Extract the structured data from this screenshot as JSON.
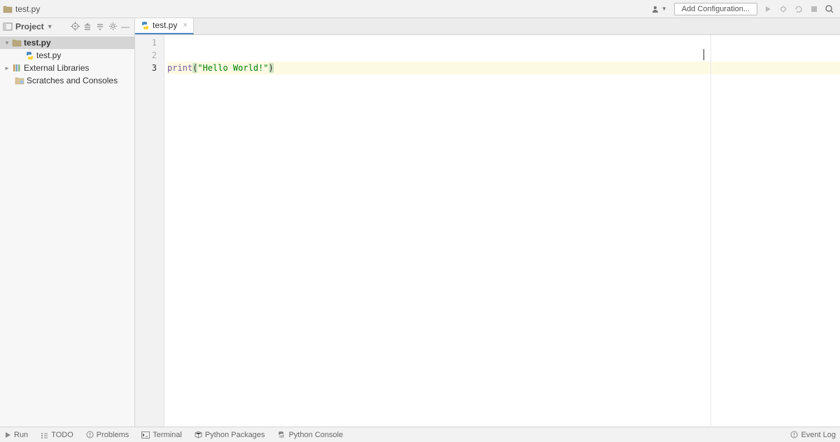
{
  "breadcrumb": {
    "root": "test.py"
  },
  "toolbar": {
    "add_configuration": "Add Configuration..."
  },
  "project": {
    "title": "Project",
    "root": {
      "label": "test.py"
    },
    "file": {
      "label": "test.py"
    },
    "external_libs": "External Libraries",
    "scratches": "Scratches and Consoles"
  },
  "editor": {
    "tab_label": "test.py",
    "lines": {
      "l1": "1",
      "l2": "2",
      "l3": "3"
    },
    "code": {
      "fn": "print",
      "open": "(",
      "close": ")",
      "str": "\"Hello World!\""
    }
  },
  "statusbar": {
    "run": "Run",
    "todo": "TODO",
    "problems": "Problems",
    "terminal": "Terminal",
    "python_packages": "Python Packages",
    "python_console": "Python Console",
    "event_log": "Event Log"
  }
}
